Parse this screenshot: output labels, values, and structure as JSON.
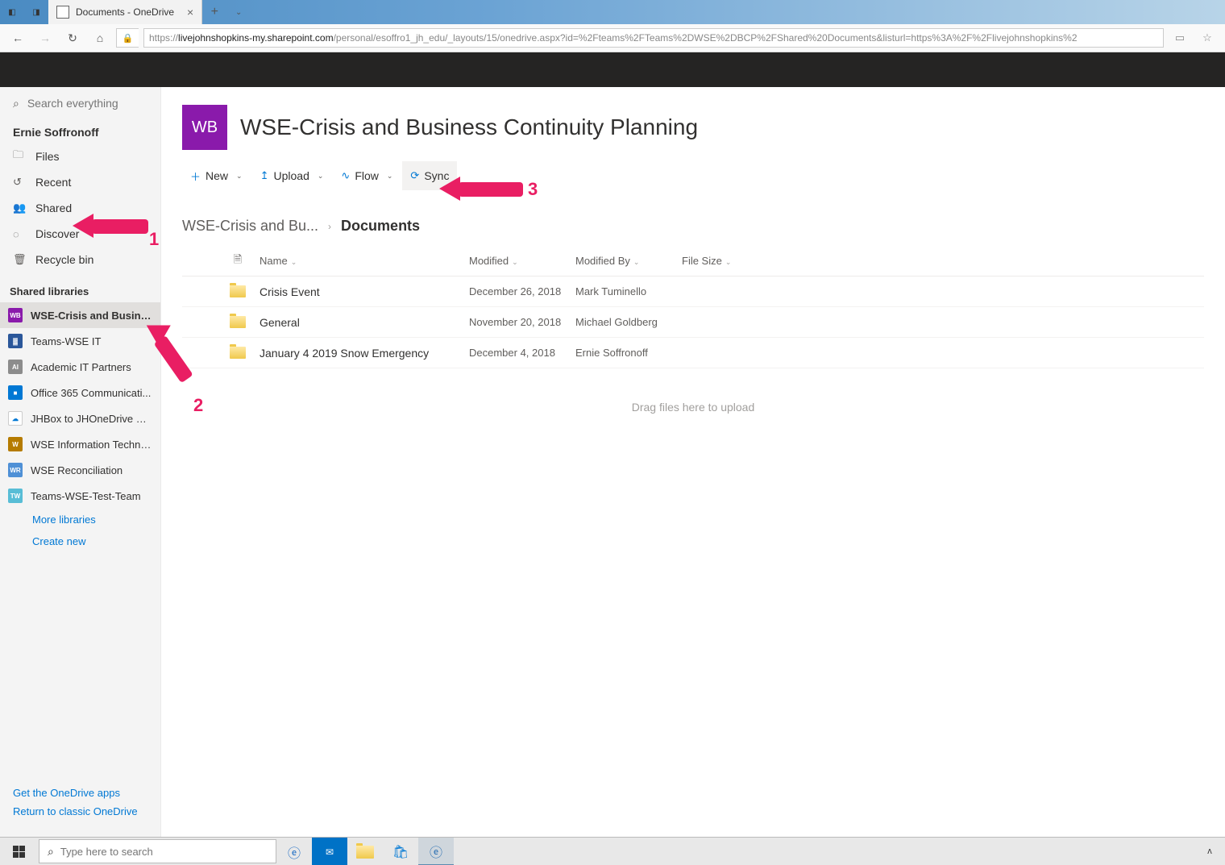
{
  "browser": {
    "tab_title": "Documents - OneDrive",
    "url_pre": "https://",
    "url_host": "livejohnshopkins-my.sharepoint.com",
    "url_path": "/personal/esoffro1_jh_edu/_layouts/15/onedrive.aspx?id=%2Fteams%2FTeams%2DWSE%2DBCP%2FShared%20Documents&listurl=https%3A%2F%2Flivejohnshopkins%2"
  },
  "sidebar": {
    "search_placeholder": "Search everything",
    "user": "Ernie Soffronoff",
    "nav": [
      {
        "icon": "🗀",
        "label": "Files"
      },
      {
        "icon": "↺",
        "label": "Recent"
      },
      {
        "icon": "👥",
        "label": "Shared"
      },
      {
        "icon": "◌",
        "label": "Discover"
      },
      {
        "icon": "🗑",
        "label": "Recycle bin"
      }
    ],
    "shared_heading": "Shared libraries",
    "libs": [
      {
        "initials": "WB",
        "color": "#8a1aab",
        "label": "WSE-Crisis and Busines..."
      },
      {
        "initials": "▓",
        "color": "#2b579a",
        "label": "Teams-WSE IT"
      },
      {
        "initials": "AI",
        "color": "#8c8c8c",
        "label": "Academic IT Partners"
      },
      {
        "initials": "■",
        "color": "#0078d4",
        "label": "Office 365 Communicati..."
      },
      {
        "initials": "☁",
        "color": "#ffffff",
        "label": "JHBox to JHOneDrive Mi..."
      },
      {
        "initials": "W",
        "color": "#b57b00",
        "label": "WSE Information Techno..."
      },
      {
        "initials": "WR",
        "color": "#4f90d6",
        "label": "WSE Reconciliation"
      },
      {
        "initials": "TW",
        "color": "#58bdd6",
        "label": "Teams-WSE-Test-Team"
      }
    ],
    "more_libs": "More libraries",
    "create_new": "Create new",
    "footer": {
      "get_apps": "Get the OneDrive apps",
      "classic": "Return to classic OneDrive"
    }
  },
  "main": {
    "logo_initials": "WB",
    "site_title": "WSE-Crisis and Business Continuity Planning",
    "cmd": {
      "new": "New",
      "upload": "Upload",
      "flow": "Flow",
      "sync": "Sync"
    },
    "breadcrumb": {
      "root": "WSE-Crisis and Bu...",
      "current": "Documents"
    },
    "cols": {
      "name": "Name",
      "modified": "Modified",
      "modifiedby": "Modified By",
      "filesize": "File Size"
    },
    "rows": [
      {
        "name": "Crisis Event",
        "modified": "December 26, 2018",
        "by": "Mark Tuminello"
      },
      {
        "name": "General",
        "modified": "November 20, 2018",
        "by": "Michael Goldberg"
      },
      {
        "name": "January 4 2019 Snow Emergency",
        "modified": "December 4, 2018",
        "by": "Ernie Soffronoff"
      }
    ],
    "drop_hint": "Drag files here to upload"
  },
  "taskbar": {
    "search_placeholder": "Type here to search"
  },
  "annotations": {
    "n1": "1",
    "n2": "2",
    "n3": "3"
  }
}
